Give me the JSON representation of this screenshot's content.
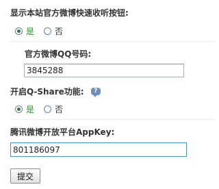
{
  "section1": {
    "label": "显示本站官方微博快速收听按钮:",
    "options": [
      {
        "text": "是",
        "checked": true
      },
      {
        "text": "否",
        "checked": false
      }
    ]
  },
  "section2": {
    "label": "官方微博QQ号码:",
    "value": "3845288"
  },
  "section3": {
    "label": "开启Q-Share功能:",
    "help_icon": "help-bubble-icon",
    "help_glyph": "?",
    "options": [
      {
        "text": "是",
        "checked": true
      },
      {
        "text": "否",
        "checked": false
      }
    ]
  },
  "section4": {
    "label": "腾讯微博开放平台AppKey:",
    "value": "801186097"
  },
  "submit_label": "提交",
  "colors": {
    "selected_text": "#2a8f2e",
    "focus_border": "#4a8fcf"
  }
}
